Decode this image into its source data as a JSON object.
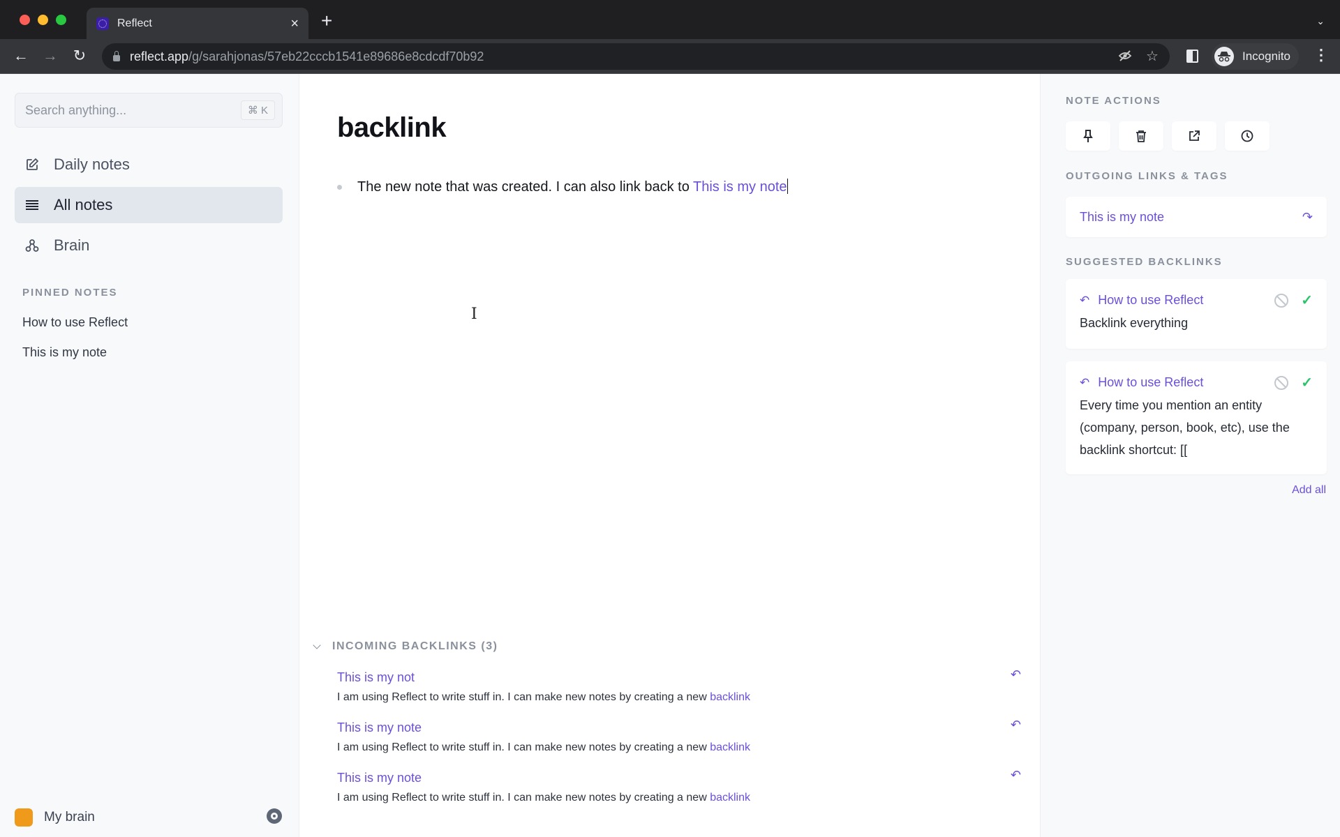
{
  "browser": {
    "tab_title": "Reflect",
    "url_host": "reflect.app",
    "url_path": "/g/sarahjonas/57eb22cccb1541e89686e8cdcdf70b92",
    "profile_label": "Incognito"
  },
  "sidebar": {
    "search_placeholder": "Search anything...",
    "search_shortcut": "⌘ K",
    "nav": [
      {
        "label": "Daily notes",
        "icon": "edit-icon",
        "active": false
      },
      {
        "label": "All notes",
        "icon": "list-icon",
        "active": true
      },
      {
        "label": "Brain",
        "icon": "graph-icon",
        "active": false
      }
    ],
    "pinned_heading": "PINNED NOTES",
    "pinned": [
      "How to use Reflect",
      "This is my note"
    ],
    "workspace": {
      "name": "My brain",
      "color": "#ef9a1a"
    }
  },
  "editor": {
    "title": "backlink",
    "bullets": [
      {
        "text": "The new note that was created. I can also link back to ",
        "link": "This is my note"
      }
    ],
    "incoming_heading": "INCOMING BACKLINKS (3)",
    "incoming": [
      {
        "title": "This is my not",
        "snippet": "I am using Reflect to write stuff in. I can make new notes by creating a new ",
        "link": "backlink"
      },
      {
        "title": "This is my note",
        "snippet": "I am using Reflect to write stuff in. I can make new notes by creating a new ",
        "link": "backlink"
      },
      {
        "title": "This is my note",
        "snippet": "I am using Reflect to write stuff in. I can make new notes by creating a new ",
        "link": "backlink"
      }
    ]
  },
  "rightpanel": {
    "actions_heading": "NOTE ACTIONS",
    "actions": [
      "pin",
      "delete",
      "open-external",
      "history"
    ],
    "outgoing_heading": "OUTGOING LINKS & TAGS",
    "outgoing": [
      "This is my note"
    ],
    "suggested_heading": "SUGGESTED BACKLINKS",
    "suggested": [
      {
        "title": "How to use Reflect",
        "text": "Backlink everything"
      },
      {
        "title": "How to use Reflect",
        "text": "Every time you mention an entity (company, person, book, etc), use the backlink shortcut: [["
      }
    ],
    "add_all": "Add all"
  },
  "colors": {
    "accent": "#6b4fd8",
    "accept": "#2cc46b"
  }
}
